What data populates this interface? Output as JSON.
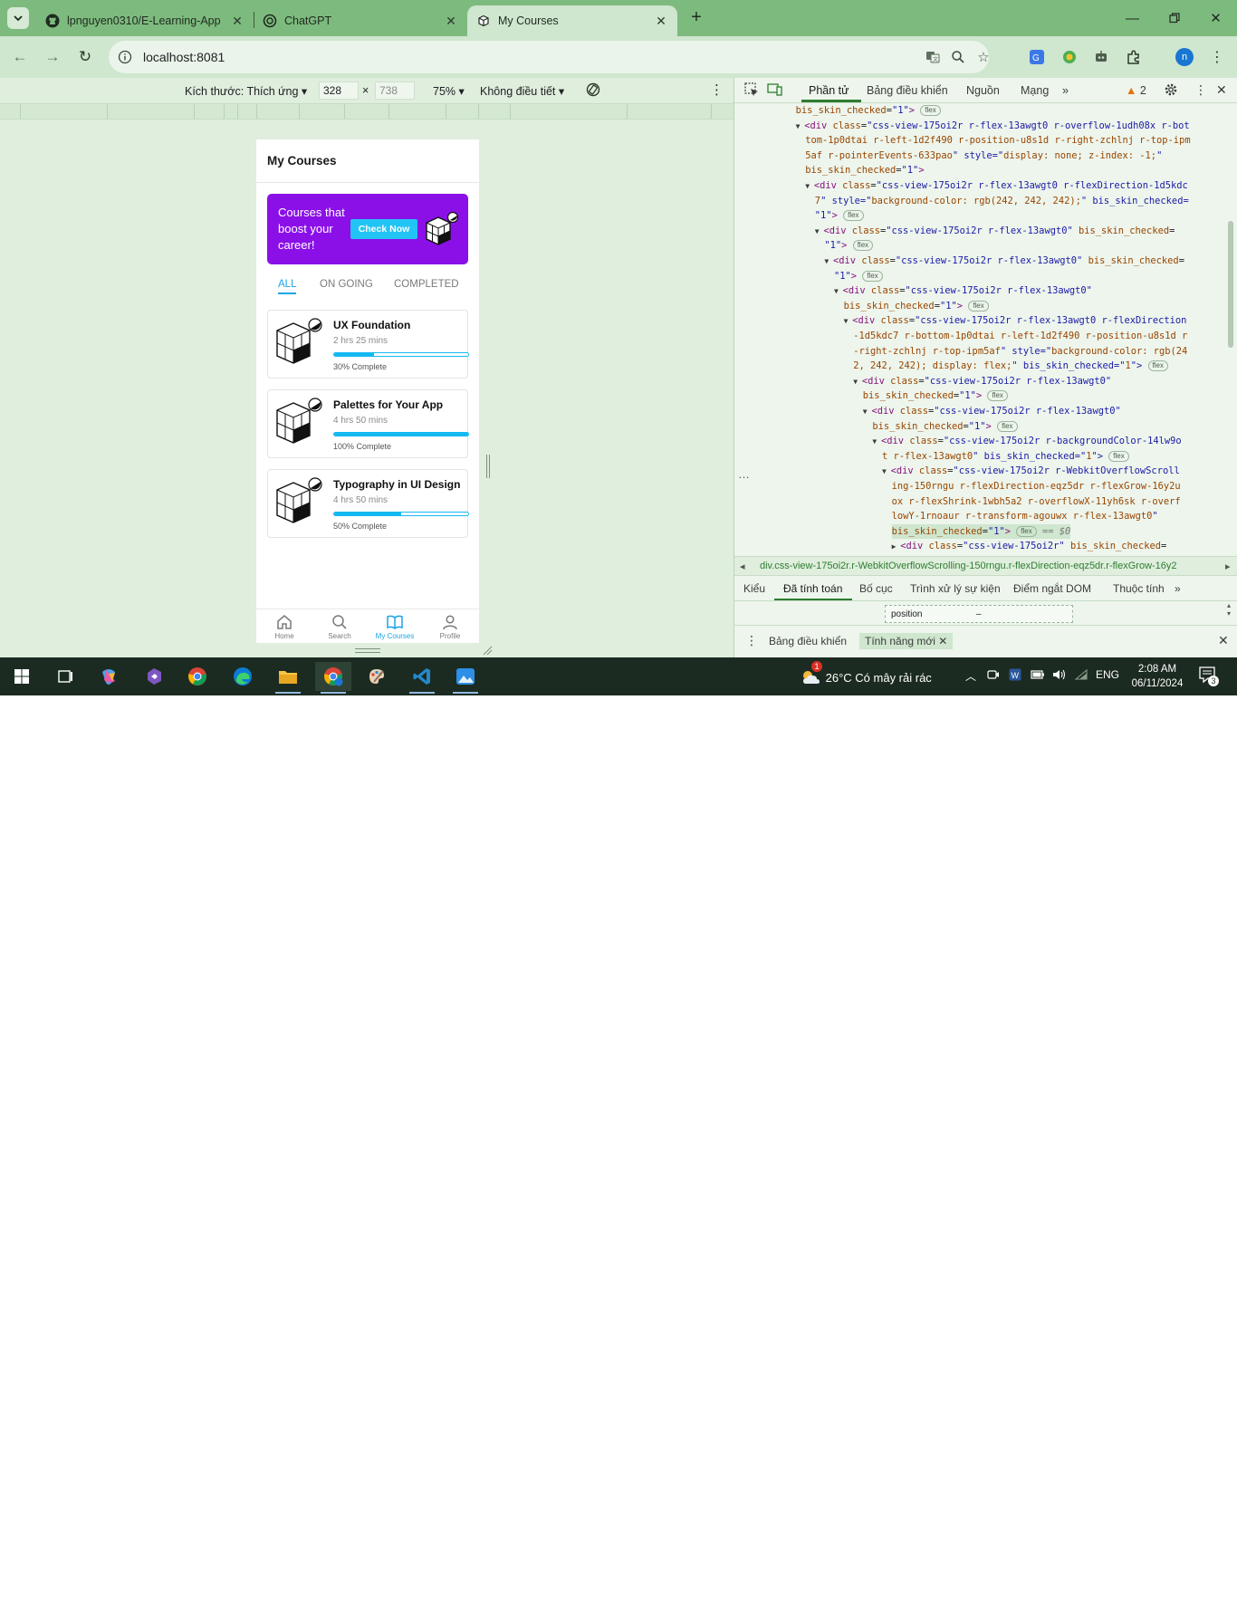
{
  "browser": {
    "tabs": [
      {
        "title": "lpnguyen0310/E-Learning-App",
        "icon": "github-icon"
      },
      {
        "title": "ChatGPT",
        "icon": "chatgpt-icon"
      },
      {
        "title": "My Courses",
        "icon": "app-cube-icon",
        "active": true
      }
    ],
    "new_tab": "+",
    "url": "localhost:8081",
    "profile_initial": "n",
    "accent": "#7dba7e"
  },
  "emulation": {
    "size_label": "Kích thước: Thích ứng",
    "width": "328",
    "height": "738",
    "times": "×",
    "zoom": "75%",
    "throttle": "Không điều tiết"
  },
  "app": {
    "title": "My Courses",
    "banner": {
      "text": "Courses that boost your career!",
      "button": "Check Now",
      "color": "#8b10e8",
      "button_color": "#22c4f5"
    },
    "filters": [
      {
        "label": "ALL",
        "selected": true
      },
      {
        "label": "ON GOING",
        "selected": false
      },
      {
        "label": "COMPLETED",
        "selected": false
      }
    ],
    "courses": [
      {
        "title": "UX Foundation",
        "duration": "2 hrs 25 mins",
        "progress": 30,
        "progress_label": "30% Complete"
      },
      {
        "title": "Palettes for Your App",
        "duration": "4 hrs 50 mins",
        "progress": 100,
        "progress_label": "100% Complete"
      },
      {
        "title": "Typography in UI Design",
        "duration": "4 hrs 50 mins",
        "progress": 50,
        "progress_label": "50% Complete"
      }
    ],
    "bottom_nav": [
      {
        "label": "Home",
        "icon": "home-icon"
      },
      {
        "label": "Search",
        "icon": "search-icon"
      },
      {
        "label": "My Courses",
        "icon": "book-icon",
        "active": true
      },
      {
        "label": "Profile",
        "icon": "profile-icon"
      }
    ]
  },
  "devtools": {
    "tabs": [
      "Phần tử",
      "Bảng điều khiển",
      "Nguồn",
      "Mạng"
    ],
    "more": "»",
    "warnings": "2",
    "code_lines": [
      {
        "indent": 6,
        "tri": "",
        "text": "bis_skin_checked=\"1\">",
        "pill": "flex"
      },
      {
        "indent": 6,
        "tri": "▼",
        "text": "<div class=\"css-view-175oi2r r-flex-13awgt0 r-overflow-1udh08x r-bot",
        "pill": ""
      },
      {
        "indent": 7,
        "tri": "",
        "text": "tom-1p0dtai r-left-1d2f490 r-position-u8s1d r-right-zchlnj r-top-ipm",
        "pill": ""
      },
      {
        "indent": 7,
        "tri": "",
        "text": "5af r-pointerEvents-633pao\" style=\"display: none; z-index: -1;\"",
        "pill": ""
      },
      {
        "indent": 7,
        "tri": "",
        "text": "bis_skin_checked=\"1\">",
        "pill": ""
      },
      {
        "indent": 7,
        "tri": "▼",
        "text": "<div class=\"css-view-175oi2r r-flex-13awgt0 r-flexDirection-1d5kdc",
        "pill": ""
      },
      {
        "indent": 8,
        "tri": "",
        "text": "7\" style=\"background-color: rgb(242, 242, 242);\" bis_skin_checked=",
        "pill": ""
      },
      {
        "indent": 8,
        "tri": "",
        "text": "\"1\">",
        "pill": "flex"
      },
      {
        "indent": 8,
        "tri": "▼",
        "text": "<div class=\"css-view-175oi2r r-flex-13awgt0\" bis_skin_checked=",
        "pill": ""
      },
      {
        "indent": 9,
        "tri": "",
        "text": "\"1\">",
        "pill": "flex"
      },
      {
        "indent": 9,
        "tri": "▼",
        "text": "<div class=\"css-view-175oi2r r-flex-13awgt0\" bis_skin_checked=",
        "pill": ""
      },
      {
        "indent": 10,
        "tri": "",
        "text": "\"1\">",
        "pill": "flex"
      },
      {
        "indent": 10,
        "tri": "▼",
        "text": "<div class=\"css-view-175oi2r r-flex-13awgt0\"",
        "pill": ""
      },
      {
        "indent": 11,
        "tri": "",
        "text": "bis_skin_checked=\"1\">",
        "pill": "flex"
      },
      {
        "indent": 11,
        "tri": "▼",
        "text": "<div class=\"css-view-175oi2r r-flex-13awgt0 r-flexDirection",
        "pill": ""
      },
      {
        "indent": 12,
        "tri": "",
        "text": "-1d5kdc7 r-bottom-1p0dtai r-left-1d2f490 r-position-u8s1d r",
        "pill": ""
      },
      {
        "indent": 12,
        "tri": "",
        "text": "-right-zchlnj r-top-ipm5af\" style=\"background-color: rgb(24",
        "pill": ""
      },
      {
        "indent": 12,
        "tri": "",
        "text": "2, 242, 242); display: flex;\" bis_skin_checked=\"1\">",
        "pill": "flex"
      },
      {
        "indent": 12,
        "tri": "▼",
        "text": "<div class=\"css-view-175oi2r r-flex-13awgt0\"",
        "pill": ""
      },
      {
        "indent": 13,
        "tri": "",
        "text": "bis_skin_checked=\"1\">",
        "pill": "flex"
      },
      {
        "indent": 13,
        "tri": "▼",
        "text": "<div class=\"css-view-175oi2r r-flex-13awgt0\"",
        "pill": ""
      },
      {
        "indent": 14,
        "tri": "",
        "text": "bis_skin_checked=\"1\">",
        "pill": "flex"
      },
      {
        "indent": 14,
        "tri": "▼",
        "text": "<div class=\"css-view-175oi2r r-backgroundColor-14lw9o",
        "pill": ""
      },
      {
        "indent": 15,
        "tri": "",
        "text": "t r-flex-13awgt0\" bis_skin_checked=\"1\">",
        "pill": "flex"
      },
      {
        "indent": 15,
        "tri": "▼",
        "text": "<div class=\"css-view-175oi2r r-WebkitOverflowScroll",
        "pill": ""
      },
      {
        "indent": 16,
        "tri": "",
        "text": "ing-150rngu r-flexDirection-eqz5dr r-flexGrow-16y2u",
        "pill": ""
      },
      {
        "indent": 16,
        "tri": "",
        "text": "ox r-flexShrink-1wbh5a2 r-overflowX-11yh6sk r-overf",
        "pill": ""
      },
      {
        "indent": 16,
        "tri": "",
        "text": "lowY-1rnoaur r-transform-agouwx r-flex-13awgt0\"",
        "pill": ""
      },
      {
        "indent": 16,
        "tri": "",
        "text": "bis_skin_checked=\"1\">",
        "pill": "flex",
        "suffix": " == $0"
      },
      {
        "indent": 16,
        "tri": "▶",
        "text": "<div class=\"css-view-175oi2r\" bis_skin_checked=",
        "pill": ""
      }
    ],
    "ellipsis": "…",
    "breadcrumb": "div.css-view-175oi2r.r-WebkitOverflowScrolling-150rngu.r-flexDirection-eqz5dr.r-flexGrow-16y2",
    "panes": [
      "Kiểu",
      "Đã tính toán",
      "Bố cục",
      "Trình xử lý sự kiện",
      "Điểm ngắt DOM",
      "Thuộc tính"
    ],
    "computed_prop": "position",
    "computed_val": "–",
    "drawer": [
      "Bảng điều khiển",
      "Tính năng mới"
    ]
  },
  "taskbar": {
    "weather": "26°C  Có mây rải rác",
    "weather_badge": "1",
    "lang": "ENG",
    "time": "2:08 AM",
    "date": "06/11/2024",
    "notifications": "3"
  }
}
